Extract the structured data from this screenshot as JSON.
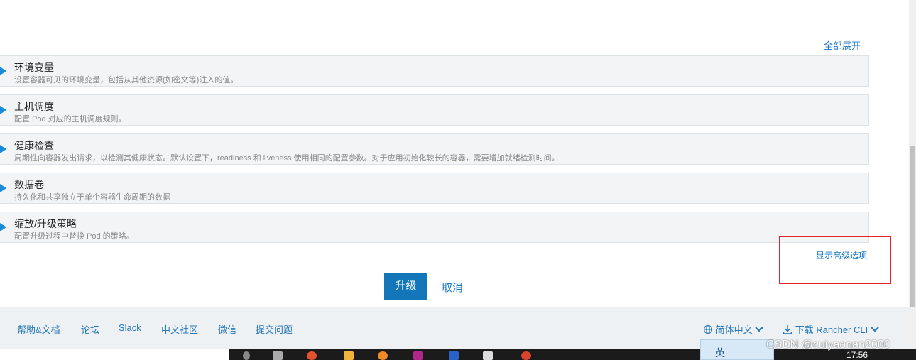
{
  "expand_all": "全部展开",
  "sections": [
    {
      "title": "环境变量",
      "desc": "设置容器可见的环境变量，包括从其他资源(如密文等)注入的值。"
    },
    {
      "title": "主机调度",
      "desc": "配置 Pod 对应的主机调度规则。"
    },
    {
      "title": "健康检查",
      "desc": "周期性向容器发出请求，以检测其健康状态。默认设置下，readiness 和 liveness 使用相同的配置参数。对于应用初始化较长的容器，需要增加就绪检测时间。"
    },
    {
      "title": "数据卷",
      "desc": "持久化和共享独立于单个容器生命周期的数据"
    },
    {
      "title": "缩放/升级策略",
      "desc": "配置升级过程中替换 Pod 的策略。"
    }
  ],
  "advanced_options": "显示高级选项",
  "buttons": {
    "upgrade": "升级",
    "cancel": "取消"
  },
  "footer": {
    "links": [
      "帮助&文档",
      "论坛",
      "Slack",
      "中文社区",
      "微信",
      "提交问题"
    ],
    "language": "简体中文",
    "download_cli": "下载 Rancher CLI"
  },
  "taskbar": {
    "ime": "英",
    "watermark": "CSDN @cuiyaonan2000",
    "clock": "17:56"
  },
  "colors": {
    "accent": "#1276b8",
    "highlight_box": "#e0262b"
  }
}
